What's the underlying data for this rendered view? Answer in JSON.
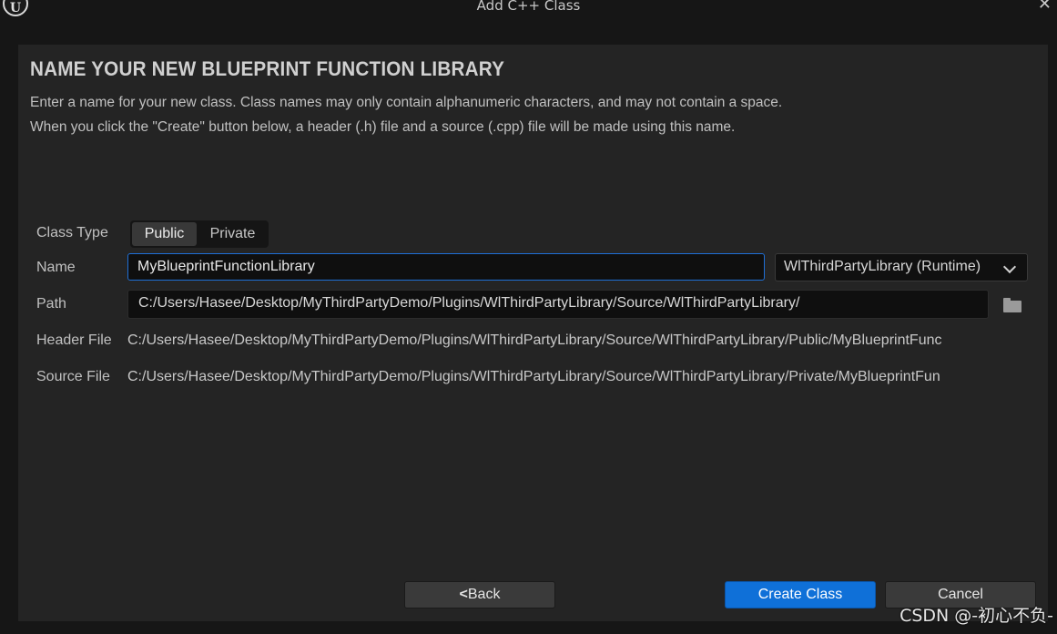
{
  "window": {
    "title": "Add C++ Class",
    "logo_text": "U",
    "close_glyph": "✕"
  },
  "heading": "NAME YOUR NEW BLUEPRINT FUNCTION LIBRARY",
  "description": [
    "Enter a name for your new class. Class names may only contain alphanumeric characters, and may not contain a space.",
    "When you click the \"Create\" button below, a header (.h) file and a source (.cpp) file will be made using this name."
  ],
  "form": {
    "class_type_label": "Class Type",
    "class_type_options": [
      "Public",
      "Private"
    ],
    "class_type_selected": "Public",
    "name_label": "Name",
    "name_value": "MyBlueprintFunctionLibrary",
    "module_value": "WlThirdPartyLibrary (Runtime)",
    "path_label": "Path",
    "path_value": "C:/Users/Hasee/Desktop/MyThirdPartyDemo/Plugins/WlThirdPartyLibrary/Source/WlThirdPartyLibrary/",
    "header_label": "Header File",
    "header_value": "C:/Users/Hasee/Desktop/MyThirdPartyDemo/Plugins/WlThirdPartyLibrary/Source/WlThirdPartyLibrary/Public/MyBlueprintFunc",
    "source_label": "Source File",
    "source_value": "C:/Users/Hasee/Desktop/MyThirdPartyDemo/Plugins/WlThirdPartyLibrary/Source/WlThirdPartyLibrary/Private/MyBlueprintFun"
  },
  "buttons": {
    "back_label": "Back",
    "back_glyph": "<",
    "create_label": "Create Class",
    "cancel_label": "Cancel"
  },
  "watermark": "CSDN @-初心不负-",
  "colors": {
    "accent": "#0f70d8",
    "panel": "#242424",
    "background": "#161616"
  }
}
